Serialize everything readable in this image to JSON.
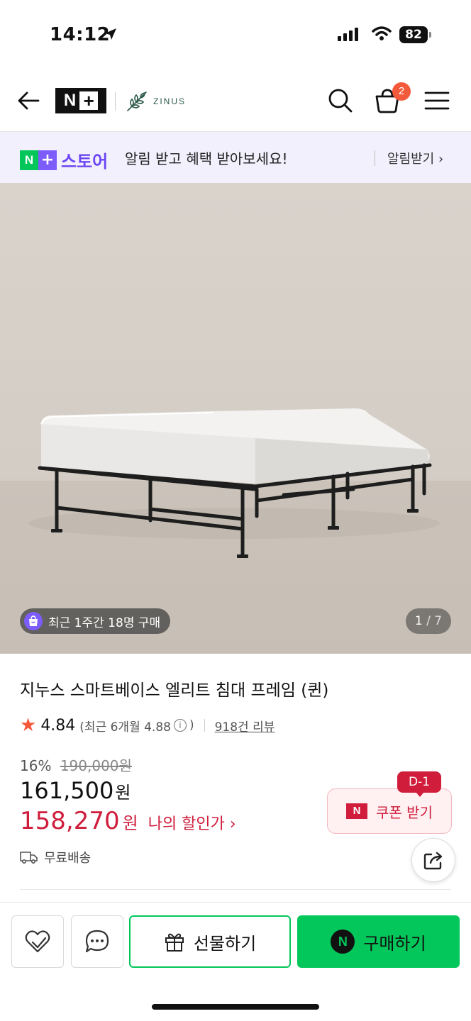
{
  "status_bar": {
    "time": "14:12",
    "battery": "82"
  },
  "header": {
    "brand_zinus": "ZINUS",
    "cart_count": "2"
  },
  "store_banner": {
    "store_name": "스토어",
    "message": "알림 받고 혜택 받아보세요!",
    "action_label": "알림받기 ›"
  },
  "hero": {
    "recent_purchase": "최근 1주간 18명 구매",
    "image_index": "1",
    "image_total": "/ 7"
  },
  "product": {
    "title": "지누스 스마트베이스 엘리트 침대 프레임 (퀸)",
    "rating": "4.84",
    "recent_rating": "(최근 6개월 4.88",
    "recent_rating_close": ")",
    "review_count": "918건 리뷰",
    "discount_rate": "16%",
    "original_price": "190,000원",
    "price": "161,500",
    "price_unit": "원",
    "my_price": "158,270",
    "my_price_unit": "원",
    "my_price_label": "나의 할인가 ›",
    "shipping": "무료배송"
  },
  "coupon": {
    "label": "쿠폰 받기",
    "dday": "D-1"
  },
  "bottom_bar": {
    "gift_label": "선물하기",
    "buy_label": "구매하기"
  },
  "colors": {
    "naver_green": "#03c75a",
    "store_purple": "#6b46f4",
    "price_red": "#d01d3c",
    "badge_orange": "#f25a3b"
  }
}
